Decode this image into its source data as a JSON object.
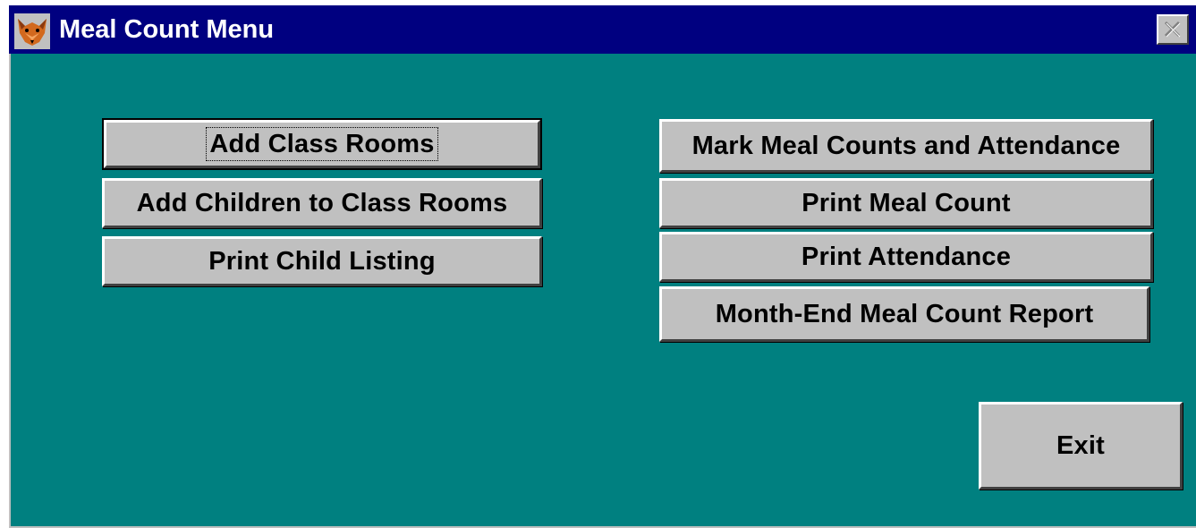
{
  "window": {
    "title": "Meal Count Menu",
    "app_icon": "fox-icon",
    "close_icon": "close-icon"
  },
  "colors": {
    "titlebar": "#000080",
    "title_text": "#ffffff",
    "client_background": "#008080",
    "button_face": "#c0c0c0"
  },
  "buttons": {
    "add_class_rooms": "Add Class Rooms",
    "add_children": "Add Children to Class Rooms",
    "print_child_listing": "Print Child Listing",
    "mark_meal_counts": "Mark Meal Counts and Attendance",
    "print_meal_count": "Print Meal Count",
    "print_attendance": "Print Attendance",
    "month_end_report": "Month-End Meal Count Report",
    "exit": "Exit"
  }
}
